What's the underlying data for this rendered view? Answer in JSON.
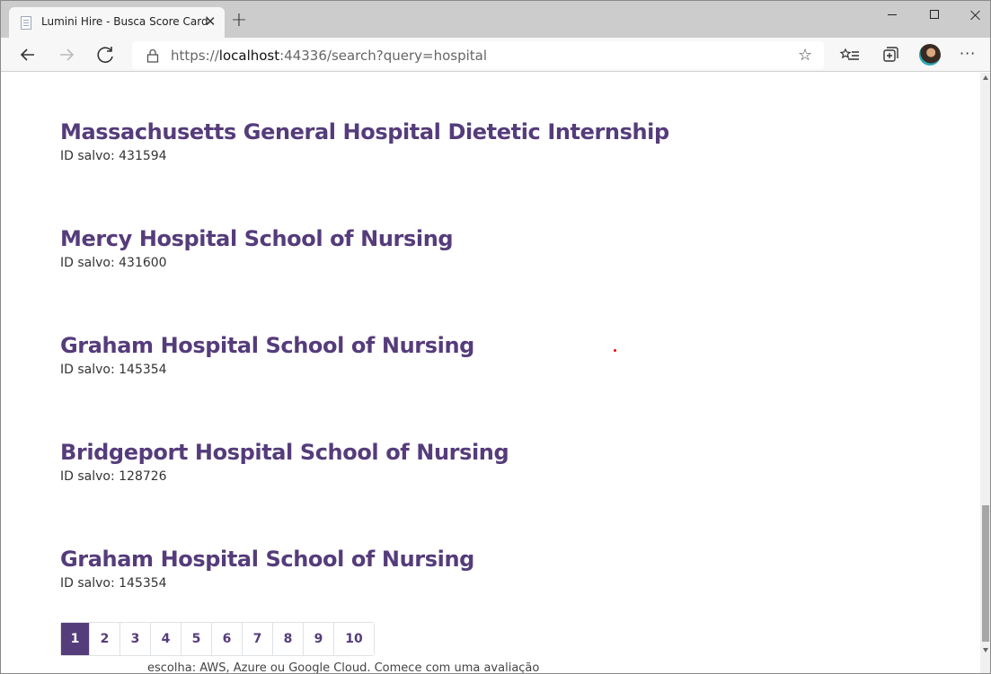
{
  "browser": {
    "tab_title": "Lumini Hire - Busca Score Card",
    "url_prefix": "https://",
    "url_host": "localhost",
    "url_rest": ":44336/search?query=hospital"
  },
  "results": [
    {
      "title": "Massachusetts General Hospital Dietetic Internship",
      "id_text": "ID salvo: 431594"
    },
    {
      "title": "Mercy Hospital School of Nursing",
      "id_text": "ID salvo: 431600"
    },
    {
      "title": "Graham Hospital School of Nursing",
      "id_text": "ID salvo: 145354"
    },
    {
      "title": "Bridgeport Hospital School of Nursing",
      "id_text": "ID salvo: 128726"
    },
    {
      "title": "Graham Hospital School of Nursing",
      "id_text": "ID salvo: 145354"
    }
  ],
  "pagination": {
    "pages": [
      "1",
      "2",
      "3",
      "4",
      "5",
      "6",
      "7",
      "8",
      "9",
      "10"
    ],
    "current": "1"
  },
  "footer_partial": "escolha: AWS, Azure ou Google Cloud. Comece com uma avaliação",
  "colors": {
    "accent": "#553c7b"
  }
}
